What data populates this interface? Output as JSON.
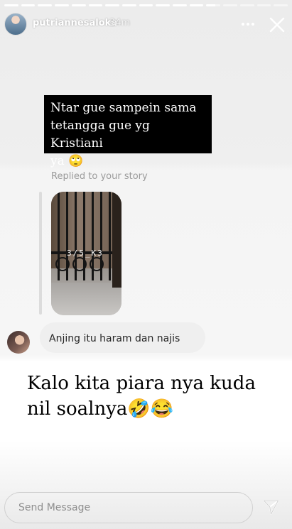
{
  "story": {
    "progress_segments": [
      1,
      1,
      1,
      1,
      1,
      1,
      1,
      1,
      1,
      1,
      1,
      1,
      0.65,
      0,
      0,
      0,
      0
    ]
  },
  "header": {
    "username": "putriannesaloka",
    "time": "34m",
    "more_icon": "more-horizontal-icon",
    "close_icon": "close-icon"
  },
  "caption": {
    "text": "Ntar gue sampein sama\ntetangga gue yg Kristiani\nya 🙄"
  },
  "reply": {
    "label": "Replied to your story",
    "sticker_text": "3/5_K3",
    "message": "Anjing itu haram dan najis"
  },
  "overlay_text": {
    "text": "Kalo kita piara nya kuda\nnil soalnya🤣😂"
  },
  "footer": {
    "placeholder": "Send Message",
    "send_icon": "send-icon"
  },
  "colors": {
    "text_primary": "#262626",
    "text_secondary": "#9a9a9a",
    "bubble": "#efefef",
    "caption_bg": "#000000"
  }
}
